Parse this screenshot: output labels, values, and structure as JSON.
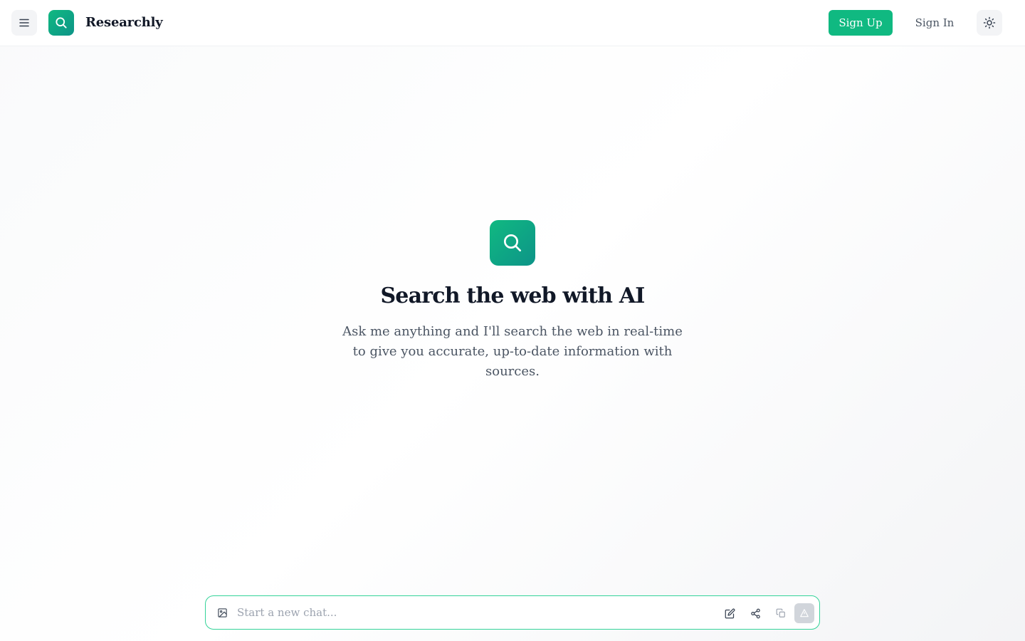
{
  "header": {
    "brand": "Researchly",
    "signup_label": "Sign Up",
    "signin_label": "Sign In",
    "icons": {
      "menu": "menu-icon",
      "logo": "search-icon",
      "theme": "sun-icon"
    }
  },
  "hero": {
    "icon": "search-icon",
    "title": "Search the web with AI",
    "subtitle": "Ask me anything and I'll search the web in real-time to give you accurate, up-to-date information with sources."
  },
  "chat": {
    "placeholder": "Start a new chat...",
    "value": "",
    "icons": [
      "image-icon",
      "edit-icon",
      "share-icon",
      "copy-icon",
      "send-icon"
    ]
  },
  "colors": {
    "accent": "#10b981",
    "accent_dark": "#0d9488",
    "text_primary": "#111827",
    "text_secondary": "#4b5563",
    "input_border": "#34d399"
  }
}
